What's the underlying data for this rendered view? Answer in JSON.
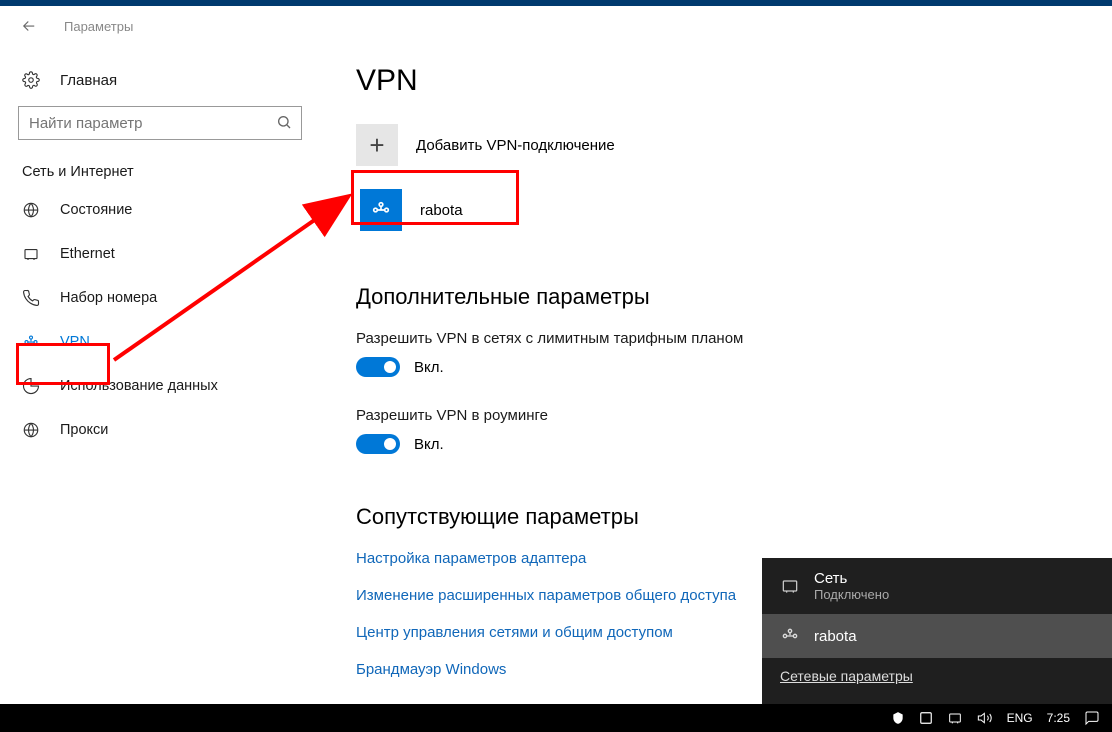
{
  "header": {
    "title": "Параметры"
  },
  "sidebar": {
    "home": "Главная",
    "search_placeholder": "Найти параметр",
    "category": "Сеть и Интернет",
    "items": [
      {
        "label": "Состояние"
      },
      {
        "label": "Ethernet"
      },
      {
        "label": "Набор номера"
      },
      {
        "label": "VPN"
      },
      {
        "label": "Использование данных"
      },
      {
        "label": "Прокси"
      }
    ]
  },
  "main": {
    "title": "VPN",
    "add_label": "Добавить VPN-подключение",
    "connection": "rabota",
    "advanced_heading": "Дополнительные параметры",
    "setting1": "Разрешить VPN в сетях с лимитным тарифным планом",
    "setting2": "Разрешить VPN в роуминге",
    "toggle_on": "Вкл.",
    "related_heading": "Сопутствующие параметры",
    "links": [
      "Настройка параметров адаптера",
      "Изменение расширенных параметров общего доступа",
      "Центр управления сетями и общим доступом",
      "Брандмауэр Windows"
    ]
  },
  "flyout": {
    "net_title": "Сеть",
    "net_status": "Подключено",
    "vpn": "rabota",
    "settings_link": "Сетевые параметры"
  },
  "taskbar": {
    "lang": "ENG",
    "time": "7:25"
  }
}
